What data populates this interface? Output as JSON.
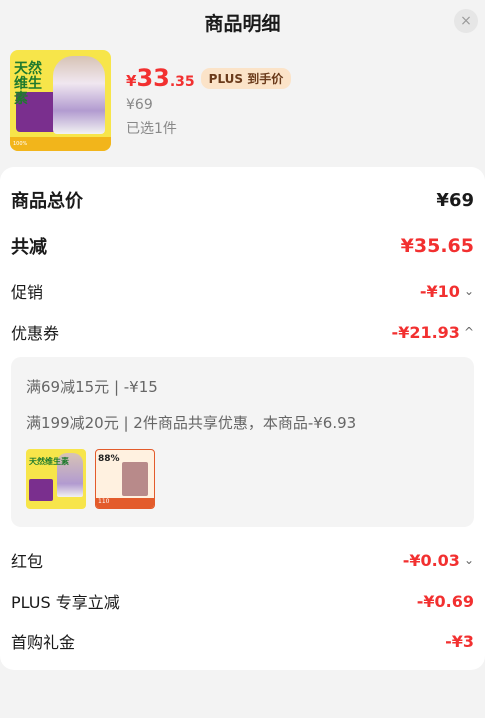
{
  "header": {
    "title": "商品明细",
    "close_icon": "×"
  },
  "product": {
    "thumb_text": "天然维生素",
    "thumb_strip": "100%",
    "price_currency": "¥",
    "price_int": "33",
    "price_dec": ".35",
    "plus_tag": "PLUS 到手价",
    "original_price": "¥69",
    "selected": "已选1件"
  },
  "summary": {
    "total_label": "商品总价",
    "total_value": "¥69",
    "discount_label": "共减",
    "discount_value": "¥35.65"
  },
  "rows": {
    "promo_label": "促销",
    "promo_value": "-¥10",
    "coupon_label": "优惠券",
    "coupon_value": "-¥21.93",
    "hongbao_label": "红包",
    "hongbao_value": "-¥0.03",
    "plus_label": "PLUS 专享立减",
    "plus_value": "-¥0.69",
    "first_label": "首购礼金",
    "first_value": "-¥3"
  },
  "coupons": {
    "line1": "满69减15元 | -¥15",
    "line2": "满199减20元 | 2件商品共享优惠，本商品-¥6.93",
    "mini1_text": "天然维生素",
    "mini2_text": "88%",
    "mini2_strip": "110"
  },
  "icons": {
    "chevron_down": "⌄",
    "chevron_up": "^"
  },
  "colors": {
    "accent_red": "#f23030",
    "plus_tag_bg": "#fbe3c8",
    "panel_bg": "#ffffff",
    "page_bg": "#f3f3f3"
  }
}
